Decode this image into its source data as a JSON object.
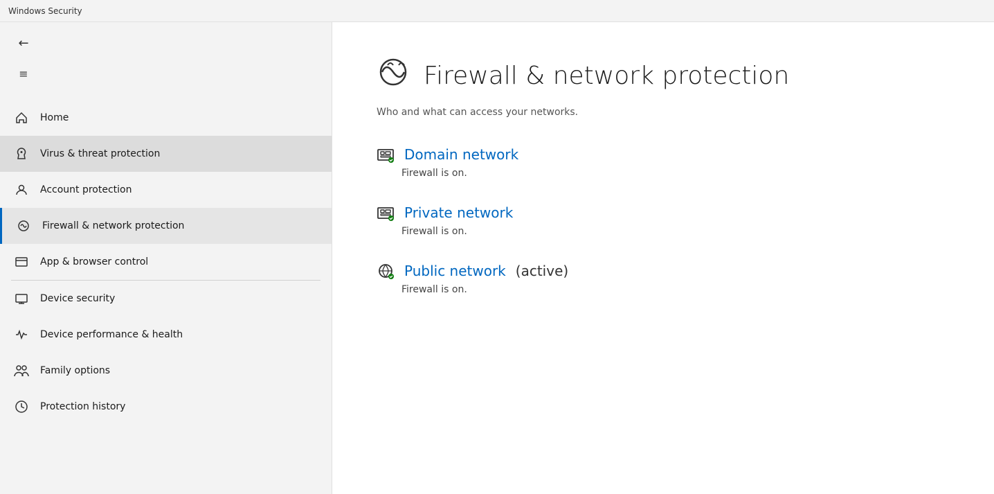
{
  "titleBar": {
    "label": "Windows Security"
  },
  "sidebar": {
    "back_label": "←",
    "hamburger_label": "≡",
    "items": [
      {
        "id": "home",
        "label": "Home",
        "icon": "🏠",
        "active": false,
        "highlighted": false
      },
      {
        "id": "virus",
        "label": "Virus & threat protection",
        "icon": "🛡",
        "active": false,
        "highlighted": true
      },
      {
        "id": "account",
        "label": "Account protection",
        "icon": "👤",
        "active": false,
        "highlighted": false
      },
      {
        "id": "firewall",
        "label": "Firewall & network protection",
        "icon": "📡",
        "active": true,
        "highlighted": false
      },
      {
        "id": "appbrowser",
        "label": "App & browser control",
        "icon": "🖥",
        "active": false,
        "highlighted": false
      },
      {
        "id": "devicesecurity",
        "label": "Device security",
        "icon": "💻",
        "active": false,
        "highlighted": false
      },
      {
        "id": "devicehealth",
        "label": "Device performance & health",
        "icon": "❤",
        "active": false,
        "highlighted": false
      },
      {
        "id": "family",
        "label": "Family options",
        "icon": "👨‍👩‍👧",
        "active": false,
        "highlighted": false
      },
      {
        "id": "history",
        "label": "Protection history",
        "icon": "🕐",
        "active": false,
        "highlighted": false
      }
    ]
  },
  "main": {
    "page_title": "Firewall & network protection",
    "page_subtitle": "Who and what can access your networks.",
    "networks": [
      {
        "id": "domain",
        "name": "Domain network",
        "active_label": "",
        "status": "Firewall is on.",
        "has_green": true
      },
      {
        "id": "private",
        "name": "Private network",
        "active_label": "",
        "status": "Firewall is on.",
        "has_green": true
      },
      {
        "id": "public",
        "name": "Public network",
        "active_label": " (active)",
        "status": "Firewall is on.",
        "has_green": true
      }
    ]
  }
}
